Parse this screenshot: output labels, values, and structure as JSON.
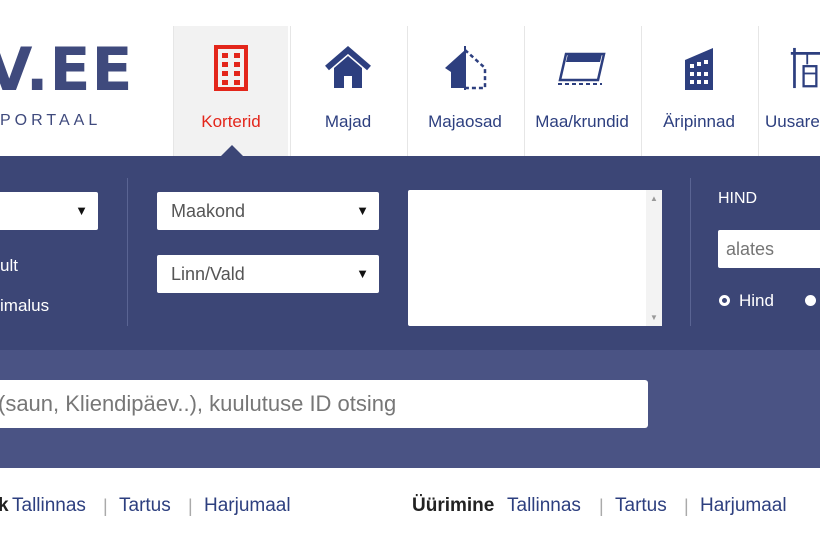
{
  "logo": {
    "text": "V.EE",
    "subtitle": "PORTAAL"
  },
  "tabs": [
    {
      "label": "Korterid",
      "icon": "apartment-building-icon",
      "active": true
    },
    {
      "label": "Majad",
      "icon": "house-icon",
      "active": false
    },
    {
      "label": "Majaosad",
      "icon": "half-house-icon",
      "active": false
    },
    {
      "label": "Maa/krundid",
      "icon": "land-plot-icon",
      "active": false
    },
    {
      "label": "Äripinnad",
      "icon": "office-building-icon",
      "active": false
    },
    {
      "label": "Uusare",
      "icon": "crane-construction-icon",
      "active": false
    }
  ],
  "colors": {
    "accent_red": "#e3261b",
    "navy": "#2d3f7f",
    "panel": "#3c4676",
    "band": "#4a5384"
  },
  "filters": {
    "type_select": {
      "value": ""
    },
    "option1_label": "ult",
    "option2_label": "imalus",
    "county_select": {
      "value": "Maakond"
    },
    "city_select": {
      "value": "Linn/Vald"
    },
    "price": {
      "heading": "HIND",
      "from_placeholder": "alates",
      "radio_price_label": "Hind"
    }
  },
  "search": {
    "placeholder": "(saun, Kliendipäev..), kuulutuse ID otsing"
  },
  "quick_links": {
    "sale_bold": "k",
    "sale_links": [
      "Tallinnas",
      "Tartus",
      "Harjumaal"
    ],
    "rent_bold": "Üürimine",
    "rent_links": [
      "Tallinnas",
      "Tartus",
      "Harjumaal"
    ],
    "separator": "|"
  }
}
